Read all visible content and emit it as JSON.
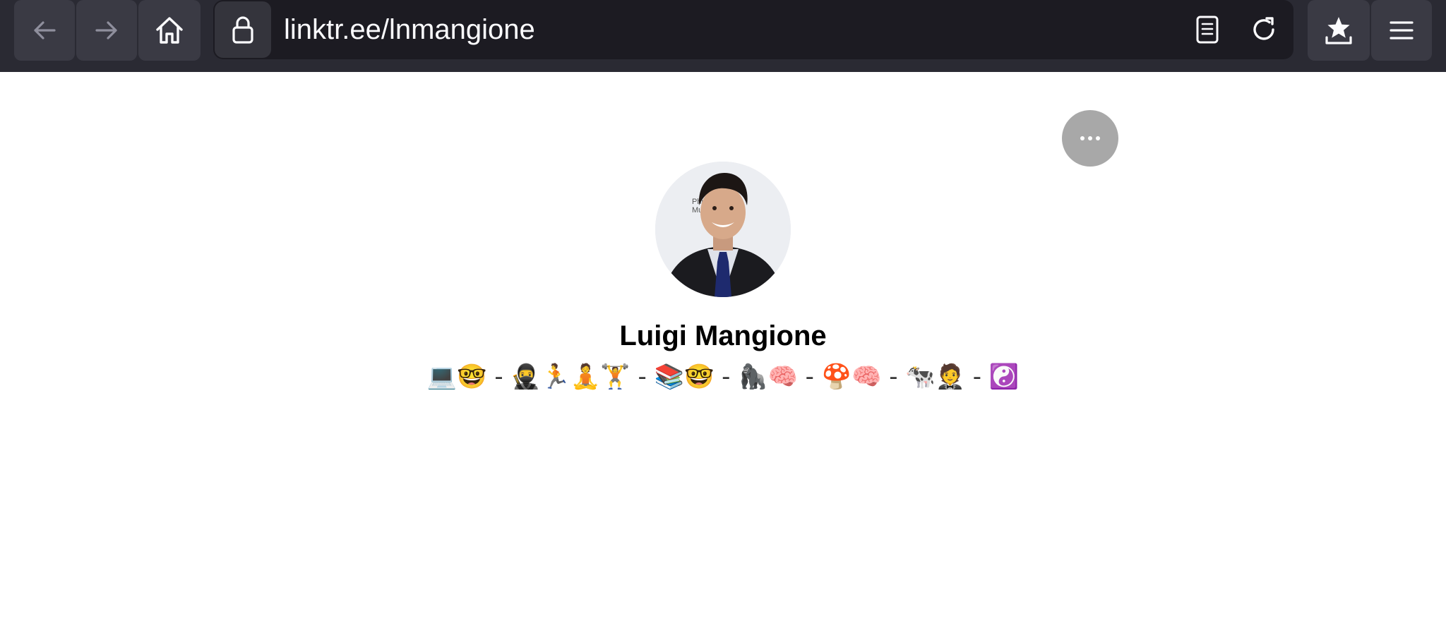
{
  "browser": {
    "url": "linktr.ee/lnmangione",
    "icons": {
      "back": "back-arrow-icon",
      "forward": "forward-arrow-icon",
      "home": "home-icon",
      "lock": "lock-icon",
      "reader": "reader-view-icon",
      "reload": "reload-icon",
      "bookmark": "bookmark-star-icon",
      "menu": "hamburger-menu-icon"
    }
  },
  "profile": {
    "name": "Luigi Mangione",
    "bio": "💻🤓 - 🥷🏃🧘🏋️ - 📚🤓 - 🦍🧠 - 🍄🧠 - 🐄🤵 - ☯️",
    "more_icon": "more-dots-icon",
    "avatar": "profile-photo"
  },
  "colors": {
    "toolbar_bg": "#2a2a33",
    "urlbar_bg": "#1c1b22",
    "button_bg": "#3a3a44",
    "more_button_bg": "#a8a8a8"
  }
}
